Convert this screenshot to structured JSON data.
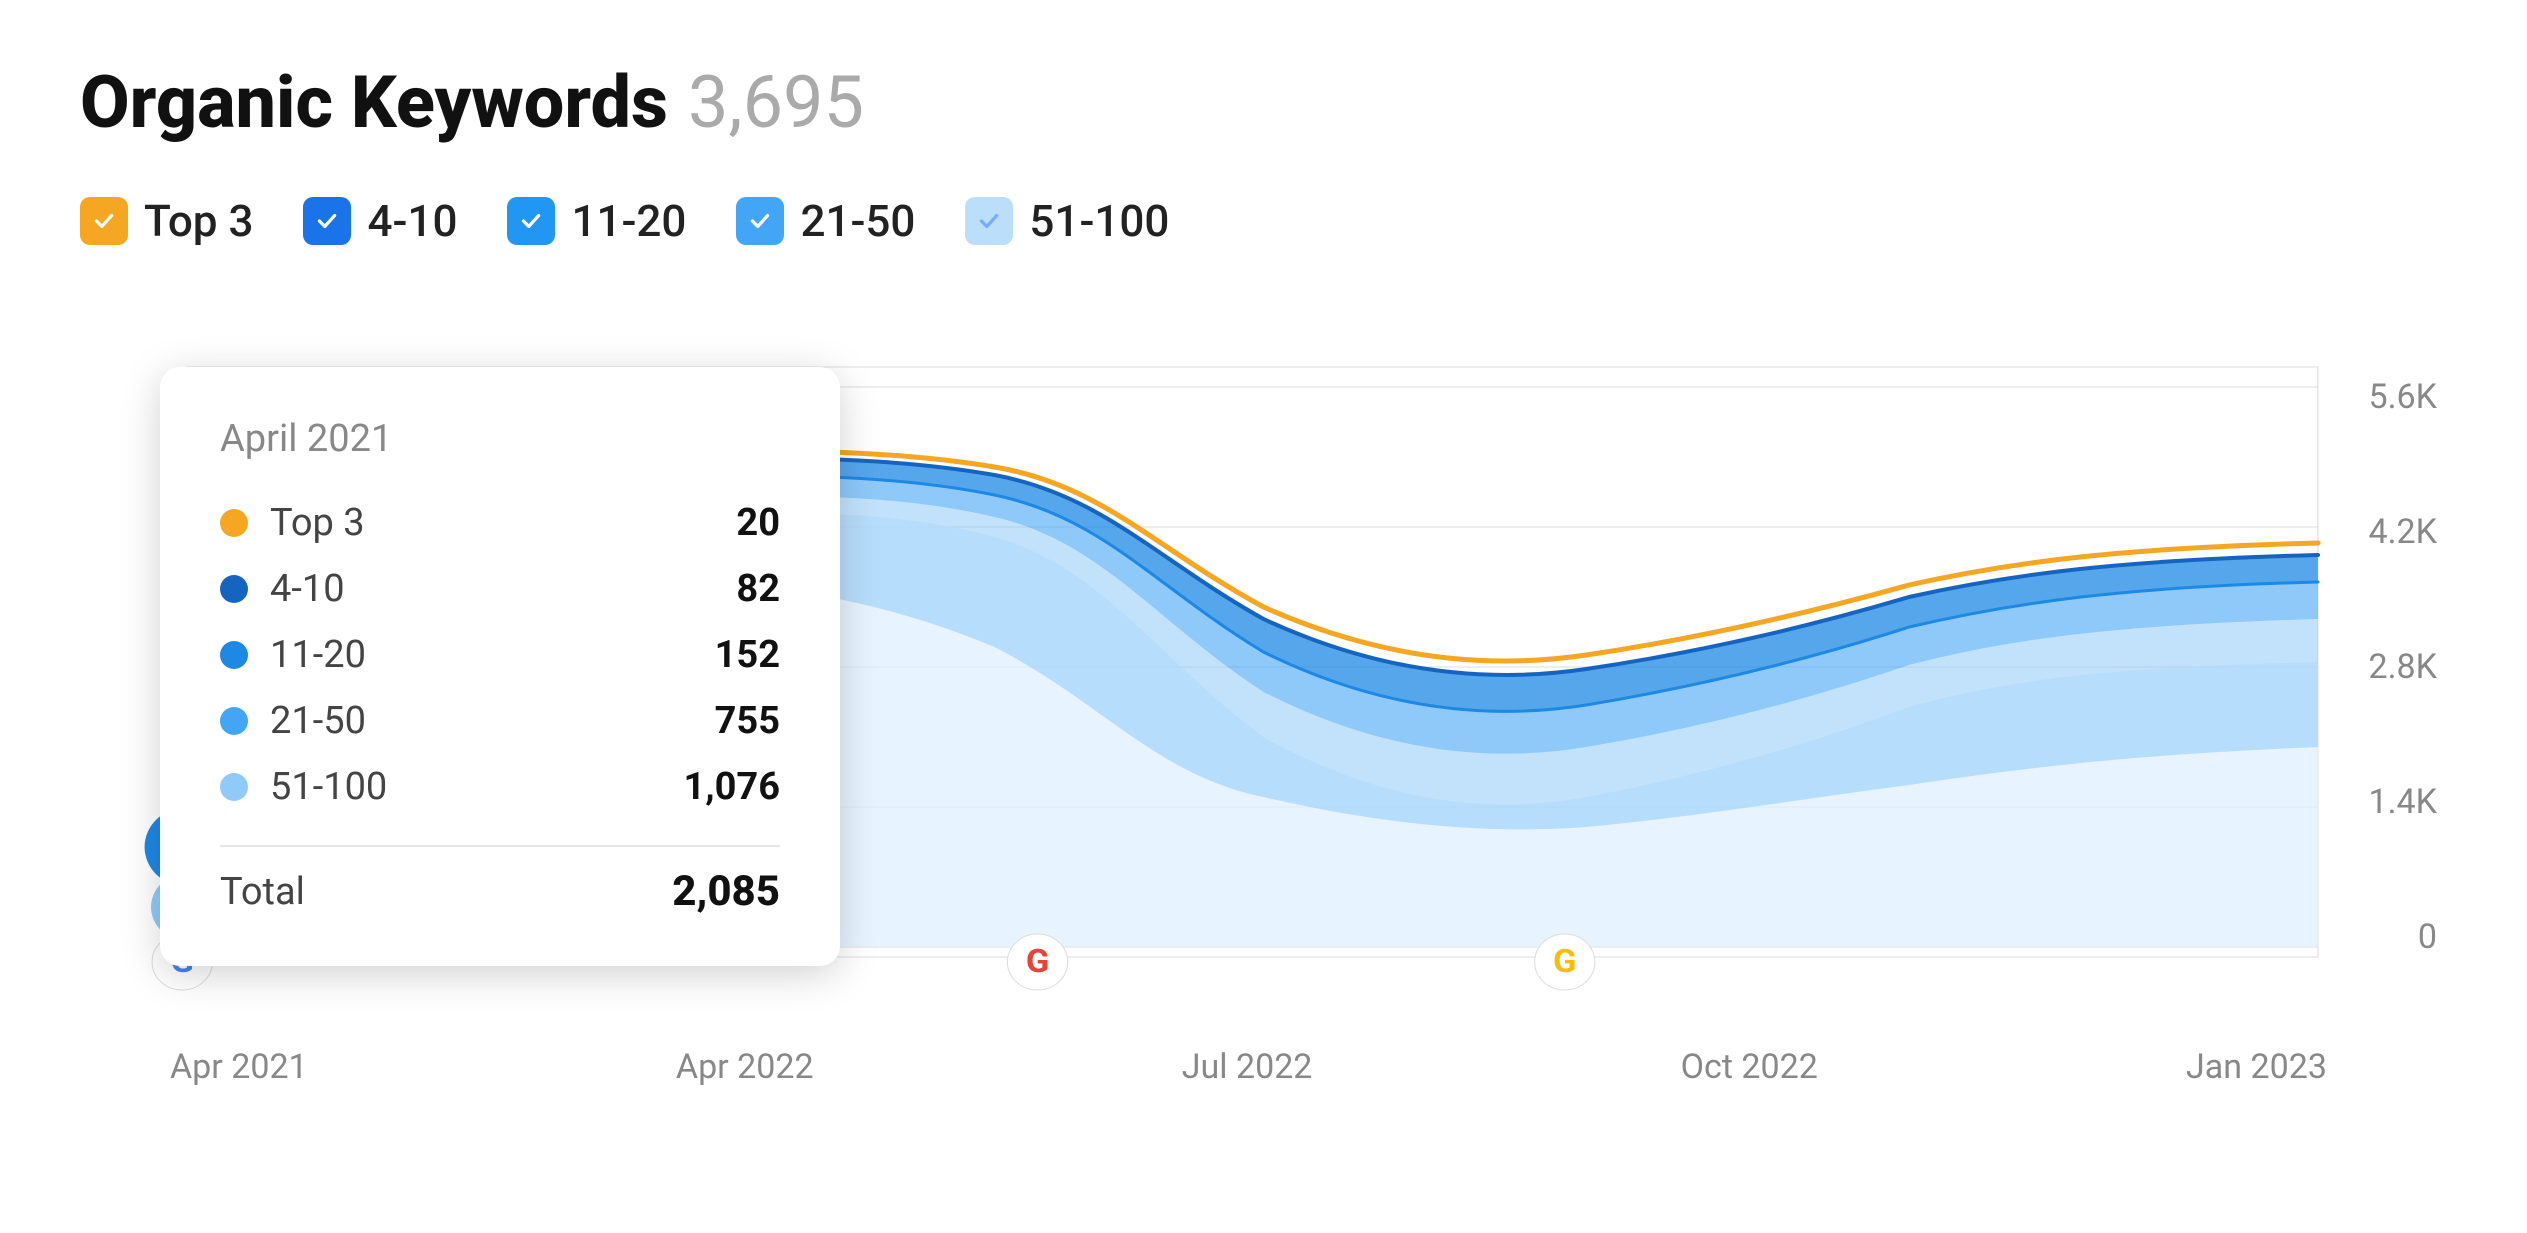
{
  "title": {
    "main": "Organic Keywords",
    "count": "3,695"
  },
  "filters": [
    {
      "id": "top3",
      "label": "Top 3",
      "color": "orange",
      "checked": true
    },
    {
      "id": "4-10",
      "label": "4-10",
      "color": "blue-dark",
      "checked": true
    },
    {
      "id": "11-20",
      "label": "11-20",
      "color": "blue-mid",
      "checked": true
    },
    {
      "id": "21-50",
      "label": "21-50",
      "color": "blue-light",
      "checked": true
    },
    {
      "id": "51-100",
      "label": "51-100",
      "color": "blue-pale",
      "checked": true
    }
  ],
  "tooltip": {
    "date": "April 2021",
    "rows": [
      {
        "id": "top3",
        "name": "Top 3",
        "value": "20",
        "dotClass": "dot-orange"
      },
      {
        "id": "4-10",
        "name": "4-10",
        "value": "82",
        "dotClass": "dot-blue-dark"
      },
      {
        "id": "11-20",
        "name": "11-20",
        "value": "152",
        "dotClass": "dot-blue-mid"
      },
      {
        "id": "21-50",
        "name": "21-50",
        "value": "755",
        "dotClass": "dot-blue-light"
      },
      {
        "id": "51-100",
        "name": "51-100",
        "value": "1,076",
        "dotClass": "dot-blue-pale"
      }
    ],
    "total_label": "Total",
    "total_value": "2,085"
  },
  "y_axis": {
    "labels": [
      "5.6K",
      "4.2K",
      "2.8K",
      "1.4K",
      "0"
    ]
  },
  "x_axis": {
    "labels": [
      "Apr 2021",
      "Apr 2022",
      "Jul 2022",
      "Oct 2022",
      "Jan 2023"
    ]
  },
  "chart": {
    "colors": {
      "top3": "#F5A623",
      "band1": "#1565C0",
      "band2": "#1E88E5",
      "band3": "#42A5F5",
      "band4": "#BBDEFB"
    }
  }
}
